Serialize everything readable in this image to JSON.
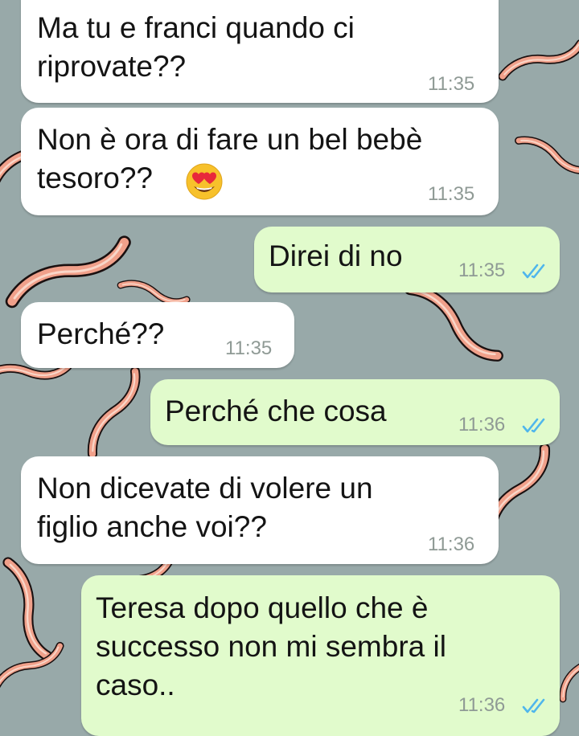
{
  "chat": {
    "messages": [
      {
        "direction": "incoming",
        "text": "Ma tu e franci quando ci\nriprovate??",
        "time": "11:35"
      },
      {
        "direction": "incoming",
        "text": "Non è ora di fare un bel bebè\ntesoro??",
        "emoji": "heart-eyes-emoji",
        "time": "11:35"
      },
      {
        "direction": "outgoing",
        "text": "Direi di no",
        "time": "11:35",
        "status": "read"
      },
      {
        "direction": "incoming",
        "text": "Perché??",
        "time": "11:35"
      },
      {
        "direction": "outgoing",
        "text": "Perché che cosa",
        "time": "11:36",
        "status": "read"
      },
      {
        "direction": "incoming",
        "text": "Non dicevate di volere un\nfiglio anche voi??",
        "time": "11:36"
      },
      {
        "direction": "outgoing",
        "text": "Teresa dopo quello che è\nsuccesso non mi sembra il\ncaso..",
        "time": "11:36",
        "status": "read"
      }
    ]
  },
  "colors": {
    "wallpaper": "#98a9a9",
    "incoming_bubble": "#ffffff",
    "outgoing_bubble": "#e1fbcc",
    "read_tick": "#4fb6ec",
    "timestamp": "#8f9a95"
  }
}
